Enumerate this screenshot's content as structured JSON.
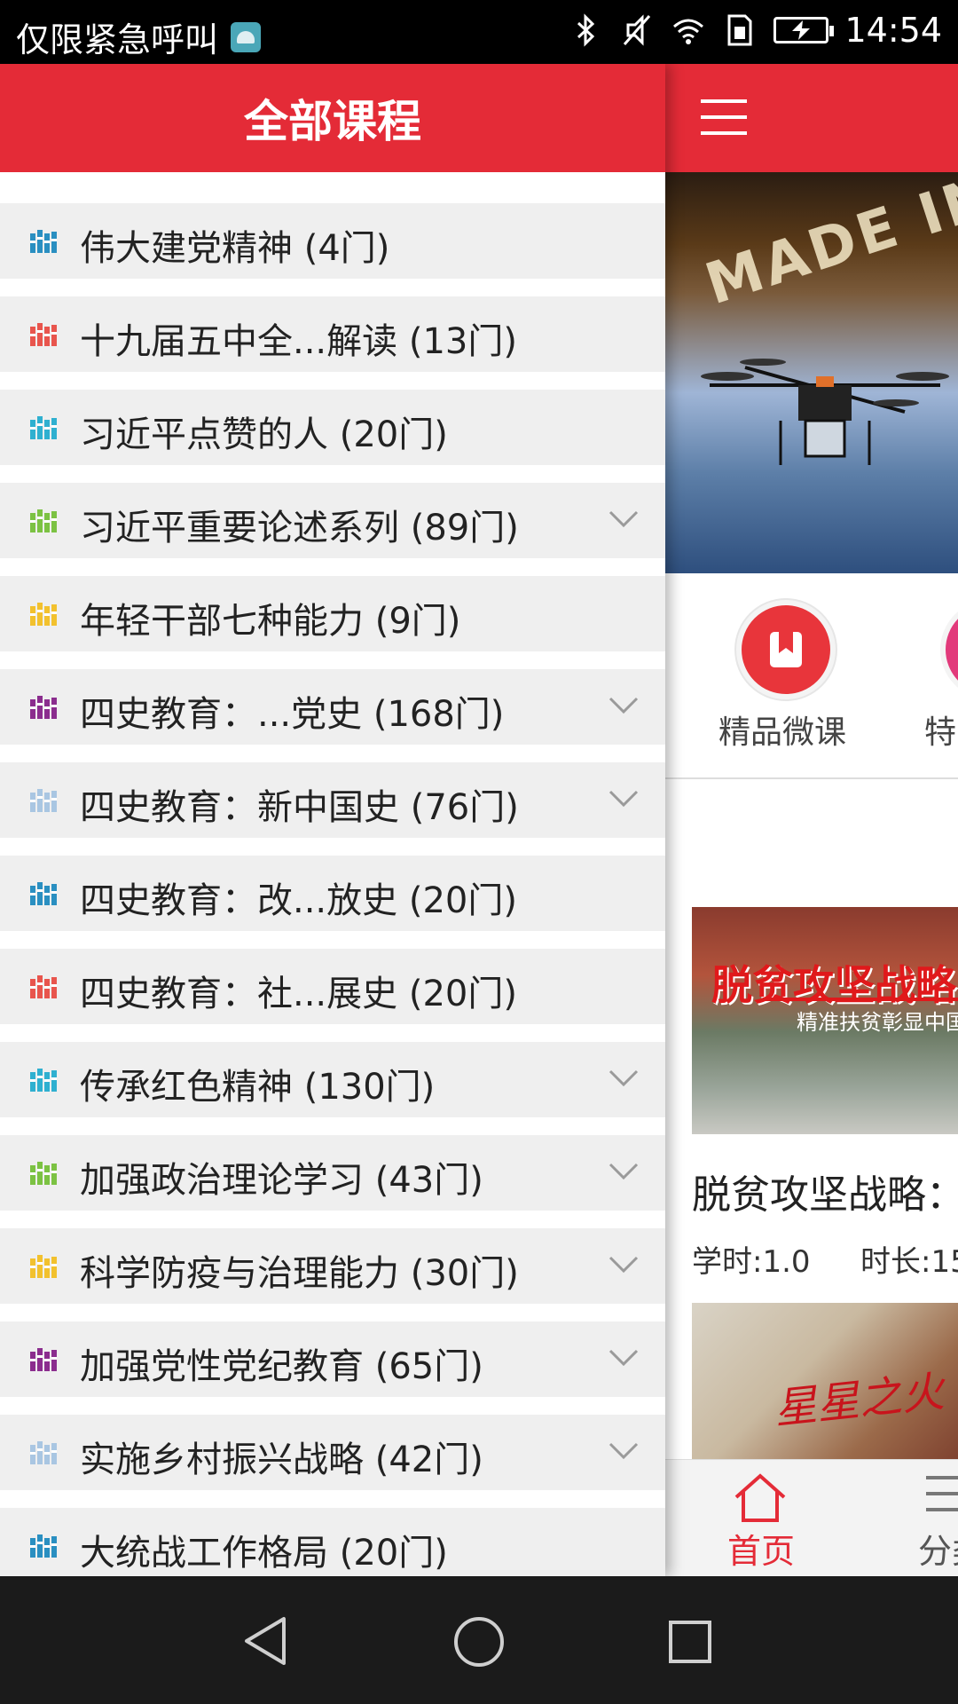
{
  "status_bar": {
    "carrier": "仅限紧急呼叫",
    "time": "14:54",
    "icons": [
      "android-notification-icon",
      "bluetooth-icon",
      "mute-icon",
      "wifi-icon",
      "sim-icon",
      "battery-charging-icon"
    ]
  },
  "drawer": {
    "title": "全部课程",
    "items": [
      {
        "label": "伟大建党精神 (4门)",
        "icon_color": "#2a8fc1",
        "expandable": false
      },
      {
        "label": "十九届五中全...解读 (13门)",
        "icon_color": "#e8554d",
        "expandable": false
      },
      {
        "label": "习近平点赞的人 (20门)",
        "icon_color": "#2fb0d0",
        "expandable": false
      },
      {
        "label": "习近平重要论述系列 (89门)",
        "icon_color": "#7cc243",
        "expandable": true
      },
      {
        "label": "年轻干部七种能力 (9门)",
        "icon_color": "#f2c12e",
        "expandable": false
      },
      {
        "label": "四史教育：...党史 (168门)",
        "icon_color": "#8b2d8e",
        "expandable": true
      },
      {
        "label": "四史教育：新中国史 (76门)",
        "icon_color": "#a9c6e2",
        "expandable": true
      },
      {
        "label": "四史教育：改...放史 (20门)",
        "icon_color": "#2a8fc1",
        "expandable": false
      },
      {
        "label": "四史教育：社...展史 (20门)",
        "icon_color": "#e8554d",
        "expandable": false
      },
      {
        "label": "传承红色精神 (130门)",
        "icon_color": "#2fb0d0",
        "expandable": true
      },
      {
        "label": "加强政治理论学习 (43门)",
        "icon_color": "#7cc243",
        "expandable": true
      },
      {
        "label": "科学防疫与治理能力 (30门)",
        "icon_color": "#f2c12e",
        "expandable": true
      },
      {
        "label": "加强党性党纪教育 (65门)",
        "icon_color": "#8b2d8e",
        "expandable": true
      },
      {
        "label": "实施乡村振兴战略 (42门)",
        "icon_color": "#a9c6e2",
        "expandable": true
      },
      {
        "label": "大统战工作格局 (20门)",
        "icon_color": "#2a8fc1",
        "expandable": false
      }
    ]
  },
  "main": {
    "banner_text": "MADE IN",
    "quick_nav": [
      {
        "label": "精品微课",
        "icon": "bookmark-book-icon"
      },
      {
        "label": "特",
        "icon": "special-icon"
      }
    ],
    "course": {
      "image_title": "脱贫攻坚战略",
      "image_subtitle": "精准扶贫彰显中国",
      "title": "脱贫攻坚战略：",
      "credits": "学时:1.0",
      "duration": "时长:15"
    },
    "course2_image_text": "星星之火"
  },
  "tab_bar": {
    "home": "首页",
    "category": "分类"
  },
  "nav_bar": {
    "back": "back-icon",
    "home": "home-circle-icon",
    "recent": "recent-apps-icon"
  }
}
